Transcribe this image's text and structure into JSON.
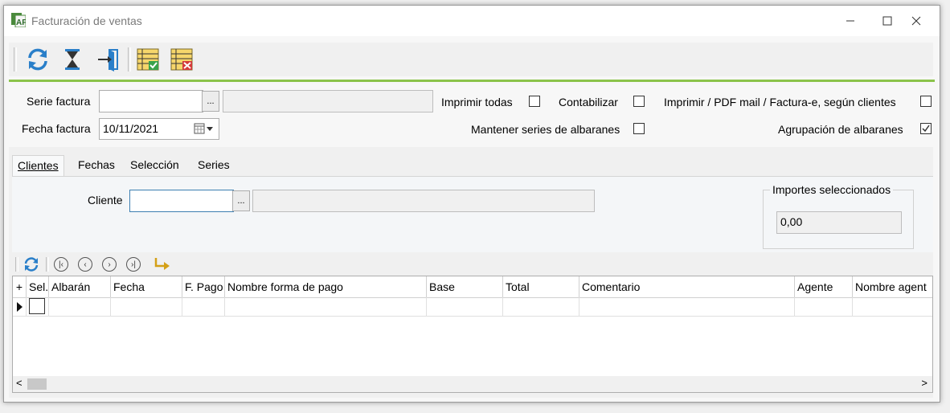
{
  "window": {
    "title": "Facturación de ventas",
    "icon": "albaran-factura-icon",
    "controls": [
      "minimize-icon",
      "maximize-icon",
      "close-icon"
    ]
  },
  "toolbar": {
    "buttons": [
      {
        "icon": "refresh-icon"
      },
      {
        "icon": "hourglass-icon"
      },
      {
        "icon": "exit-door-icon"
      },
      {
        "icon": "list-check-icon"
      },
      {
        "icon": "list-cancel-icon"
      }
    ]
  },
  "header": {
    "serie_label": "Serie factura",
    "serie_value": "",
    "serie_desc": "",
    "fecha_label": "Fecha factura",
    "fecha_value": "10/11/2021",
    "imprimir_todas_label": "Imprimir todas",
    "imprimir_todas_checked": false,
    "contabilizar_label": "Contabilizar",
    "contabilizar_checked": false,
    "imprimir_pdf_label": "Imprimir / PDF mail / Factura-e, según clientes",
    "imprimir_pdf_checked": false,
    "mantener_label": "Mantener series de albaranes",
    "mantener_checked": false,
    "agrupacion_label": "Agrupación de albaranes",
    "agrupacion_checked": true,
    "dots": "..."
  },
  "tabs": [
    {
      "label": "Clientes",
      "active": true
    },
    {
      "label": "Fechas",
      "active": false
    },
    {
      "label": "Selección",
      "active": false
    },
    {
      "label": "Series",
      "active": false
    }
  ],
  "clientes_tab": {
    "cliente_label": "Cliente",
    "cliente_value": "",
    "cliente_desc": "",
    "importes_label": "Importes seleccionados",
    "importes_value": "0,00",
    "dots": "..."
  },
  "grid": {
    "add_symbol": "+",
    "columns": [
      "Sel.",
      "Albarán",
      "Fecha",
      "F. Pago",
      "Nombre forma de pago",
      "Base",
      "Total",
      "Comentario",
      "Agente",
      "Nombre agent"
    ],
    "rows": [
      {
        "sel": false
      }
    ],
    "scroll_left": "<",
    "scroll_right": ">"
  },
  "colors": {
    "accent_line": "#8bc34a",
    "window_bg": "#f7f7f7"
  }
}
